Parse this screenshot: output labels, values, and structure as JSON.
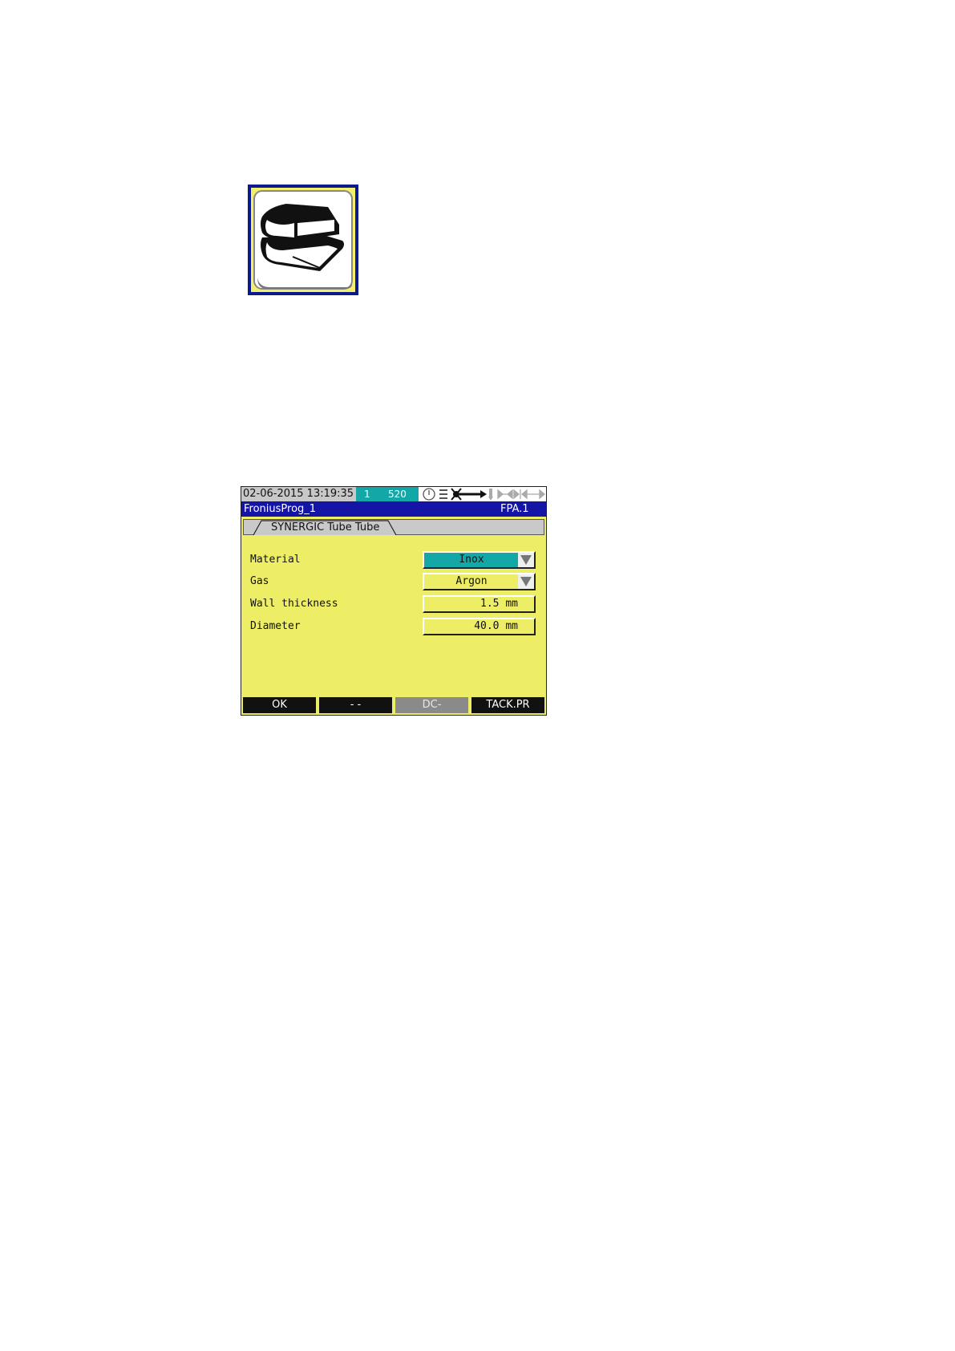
{
  "book_icon": {
    "name": "book-stack-icon"
  },
  "screen": {
    "status": {
      "datetime": "02-06-2015 13:19:35",
      "job_number": "1",
      "value": "520",
      "icons": [
        "clock-icon",
        "menu-lines-icon",
        "wire-feed-icon",
        "torch-icon",
        "transport-arrows-icon"
      ]
    },
    "title": {
      "program": "FroniusProg_1",
      "code": "FPA.1"
    },
    "tab": {
      "label": "SYNERGIC Tube Tube"
    },
    "rows": [
      {
        "label": "Material",
        "value": "Inox",
        "kind": "select",
        "highlighted": true
      },
      {
        "label": "Gas",
        "value": "Argon",
        "kind": "select",
        "highlighted": false
      },
      {
        "label": "Wall thickness",
        "value": "1.5 mm",
        "kind": "number",
        "highlighted": false
      },
      {
        "label": "Diameter",
        "value": "40.0 mm",
        "kind": "number",
        "highlighted": false
      }
    ],
    "softkeys": [
      {
        "label": "OK",
        "enabled": true
      },
      {
        "label": "- -",
        "enabled": true
      },
      {
        "label": "DC-",
        "enabled": false
      },
      {
        "label": "TACK.PR",
        "enabled": true
      }
    ]
  },
  "colors": {
    "screen_bg": "#eeee66",
    "title_bg": "#1414a6",
    "highlight": "#14a7a7",
    "status_grey": "#c8c8c8"
  }
}
